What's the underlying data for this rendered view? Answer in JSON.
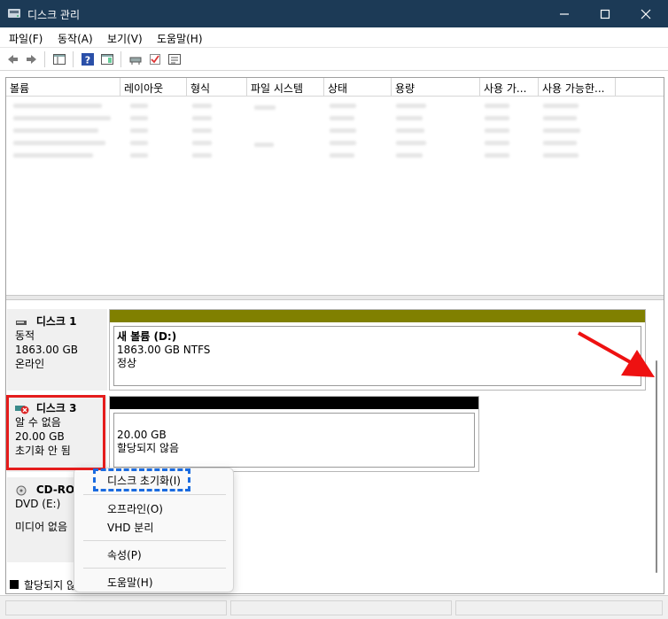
{
  "window": {
    "title": "디스크 관리",
    "controls": {
      "minimize": "minimize-icon",
      "maximize": "maximize-icon",
      "close": "close-icon"
    }
  },
  "menu": [
    "파일(F)",
    "동작(A)",
    "보기(V)",
    "도움말(H)"
  ],
  "toolbar": [
    "back-icon",
    "forward-icon",
    "show-hide-console-tree-icon",
    "help-icon",
    "action-pane-icon",
    "connect-drive-icon",
    "check-icon",
    "properties-icon"
  ],
  "volume_list": {
    "columns": [
      "볼륨",
      "레이아웃",
      "형식",
      "파일 시스템",
      "상태",
      "용량",
      "사용 가...",
      "사용 가능한..."
    ]
  },
  "disks": [
    {
      "icon": "hard-disk-icon",
      "name": "디스크 1",
      "type": "동적",
      "size": "1863.00 GB",
      "status": "온라인",
      "partition": {
        "title": "새 볼륨  (D:)",
        "detail": "1863.00 GB NTFS",
        "state": "정상",
        "stripe_color": "#808000"
      }
    },
    {
      "icon": "disk-error-icon",
      "name": "디스크 3",
      "type": "알 수 없음",
      "size": "20.00 GB",
      "status": "초기화 안 됨",
      "partition": {
        "detail": "20.00 GB",
        "state": "할당되지 않음",
        "stripe_color": "#000000"
      }
    },
    {
      "icon": "cd-rom-icon",
      "name": "CD-ROM",
      "type": "DVD (E:)",
      "status": "미디어 없음"
    }
  ],
  "legend": {
    "label": "할당되지 않음",
    "color": "#000000"
  },
  "context_menu": {
    "items": [
      "디스크 초기화(I)",
      "오프라인(O)",
      "VHD 분리",
      "속성(P)",
      "도움말(H)"
    ]
  },
  "annotations": {
    "red_box_color": "#e51c1c",
    "blue_box_color": "#1a6be0",
    "arrow_color": "#ee1111"
  }
}
